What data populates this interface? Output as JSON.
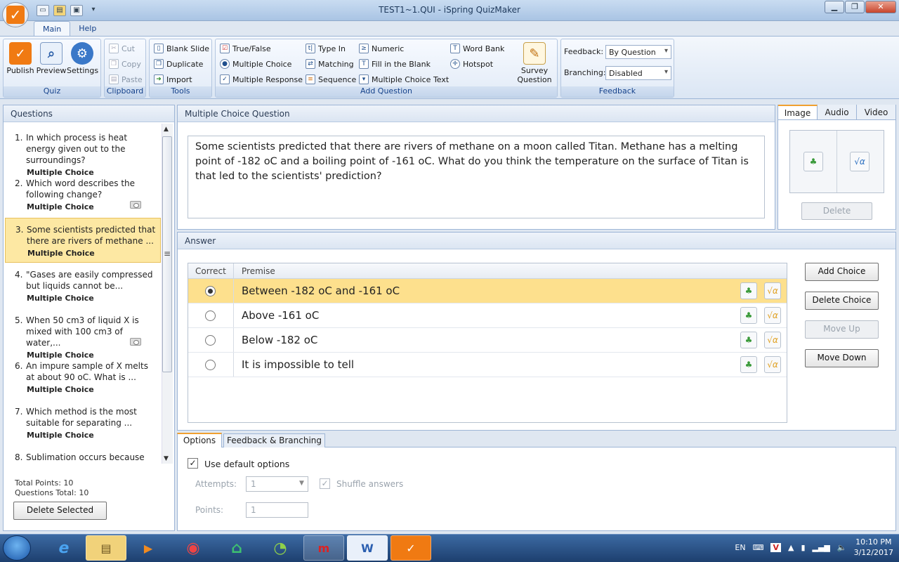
{
  "window": {
    "title": "TEST1~1.QUI - iSpring QuizMaker"
  },
  "ribbon": {
    "tabs": [
      "Main",
      "Help"
    ],
    "quiz": {
      "publish": "Publish",
      "preview": "Preview",
      "settings": "Settings",
      "label": "Quiz"
    },
    "clipboard": {
      "cut": "Cut",
      "copy": "Copy",
      "paste": "Paste",
      "label": "Clipboard"
    },
    "tools": {
      "blank_slide": "Blank Slide",
      "duplicate": "Duplicate",
      "import": "Import",
      "label": "Tools"
    },
    "add_question": {
      "true_false": "True/False",
      "multiple_choice": "Multiple Choice",
      "multiple_response": "Multiple Response",
      "type_in": "Type In",
      "matching": "Matching",
      "sequence": "Sequence",
      "numeric": "Numeric",
      "fill_blank": "Fill in the Blank",
      "mc_text": "Multiple Choice Text",
      "word_bank": "Word Bank",
      "hotspot": "Hotspot",
      "survey_line1": "Survey",
      "survey_line2": "Question",
      "label": "Add Question"
    },
    "feedback": {
      "feedback_label": "Feedback:",
      "feedback_value": "By Question",
      "branching_label": "Branching:",
      "branching_value": "Disabled",
      "label": "Feedback"
    }
  },
  "questions_panel": {
    "title": "Questions",
    "items": [
      {
        "num": "1.",
        "text": "In which process is heat energy given out to the surroundings?",
        "type": "Multiple Choice"
      },
      {
        "num": "2.",
        "text": "Which word describes the following change?",
        "type": "Multiple Choice"
      },
      {
        "num": "3.",
        "text": "Some scientists predicted that there are rivers of methane ...",
        "type": "Multiple Choice"
      },
      {
        "num": "4.",
        "text": "\"Gases are easily compressed but liquids cannot be...",
        "type": "Multiple Choice"
      },
      {
        "num": "5.",
        "text": "When 50 cm3 of liquid X is mixed with 100 cm3 of water,...",
        "type": "Multiple Choice"
      },
      {
        "num": "6.",
        "text": "An impure sample of X melts at about 90 oC. What is ...",
        "type": "Multiple Choice"
      },
      {
        "num": "7.",
        "text": "Which method is the most suitable for separating ...",
        "type": "Multiple Choice"
      },
      {
        "num": "8.",
        "text": "Sublimation occurs because",
        "type": ""
      }
    ],
    "total_points": "Total Points: 10",
    "questions_total": "Questions Total: 10",
    "delete_selected": "Delete Selected"
  },
  "question": {
    "header": "Multiple Choice Question",
    "text": "Some scientists predicted that there are rivers of methane on a moon called Titan. Methane has a melting point of -182 oC and a boiling point of -161 oC. What do you think the temperature on the surface of Titan is that led to the scientists' prediction?"
  },
  "media": {
    "tabs": [
      "Image",
      "Audio",
      "Video"
    ],
    "delete": "Delete"
  },
  "answer": {
    "header": "Answer",
    "col_correct": "Correct",
    "col_premise": "Premise",
    "choices": [
      {
        "text": "Between -182 oC  and -161 oC",
        "correct": true
      },
      {
        "text": "Above -161 oC",
        "correct": false
      },
      {
        "text": "Below -182 oC",
        "correct": false
      },
      {
        "text": "It is impossible to tell",
        "correct": false
      }
    ],
    "add_choice": "Add Choice",
    "delete_choice": "Delete Choice",
    "move_up": "Move Up",
    "move_down": "Move Down"
  },
  "options": {
    "tabs": [
      "Options",
      "Feedback & Branching"
    ],
    "use_default": "Use default options",
    "attempts_label": "Attempts:",
    "attempts_value": "1",
    "shuffle": "Shuffle answers",
    "points_label": "Points:",
    "points_value": "1"
  },
  "taskbar": {
    "lang": "EN",
    "time": "10:10 PM",
    "date": "3/12/2017"
  }
}
